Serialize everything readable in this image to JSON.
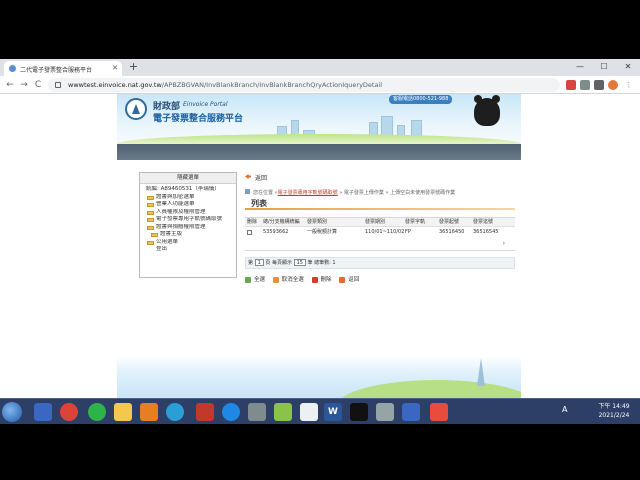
{
  "browser": {
    "tab_title": "二代電子發票整合服務平台",
    "url_host": "wwwtest.einvoice.nat.gov.tw",
    "url_path": "/APBZBGVAN/InvBlankBranch/InvBlankBranchQryActionIqueryDetail",
    "controls": {
      "back": "←",
      "forward": "→",
      "reload": "C",
      "new_tab": "+",
      "minimize": "—",
      "maximize": "☐",
      "close": "✕"
    }
  },
  "site": {
    "org_name": "財政部",
    "org_name_en": "Einvoice Portal",
    "platform_name": "電子發票整合服務平台",
    "hotline": "客服電話0800-521-988"
  },
  "sidebar": {
    "title": "隱藏選單",
    "user": "統編: A89460531（李瑞儀）",
    "items": [
      "證書與加密選單",
      "營業人功能選單",
      "人員權限及權限管理",
      "電子發票專用字軌號碼取號",
      "證書與捐贈權限管理",
      "證書主版",
      "公用選單",
      "登出"
    ]
  },
  "main": {
    "back_label": "返回",
    "breadcrumb_prefix": "您在位置 »",
    "breadcrumb_link": "電子發票專用字軌號碼取號",
    "breadcrumb_rest": "» 電子發票上傳作業 » 上傳空白未使用發票號碼作業",
    "section_title": "列表",
    "grid": {
      "headers": [
        "刪除",
        "總/分支機構統編",
        "發票類別",
        "發票期別",
        "發票字軌",
        "發票起號",
        "發票迄號"
      ],
      "rows": [
        [
          "",
          "53593662",
          "一般稅額計算",
          "110/01~110/02",
          "FP",
          "36516450",
          "36516545"
        ]
      ]
    },
    "pager": {
      "prefix": "第",
      "page": "1",
      "mid": "頁 每頁顯示",
      "page_size": "15",
      "suffix": "筆",
      "total": "總筆數: 1"
    },
    "actions": [
      "全選",
      "取消全選",
      "刪除",
      "返回"
    ]
  },
  "taskbar": {
    "time": "下午 14:49",
    "date": "2021/2/24",
    "tray_lang": "A"
  },
  "colors": {
    "accent_orange": "#e5a23e",
    "link_red": "#c0392b",
    "platform_blue": "#1b5fa0",
    "taskbar_blue": "#2d3f66"
  }
}
